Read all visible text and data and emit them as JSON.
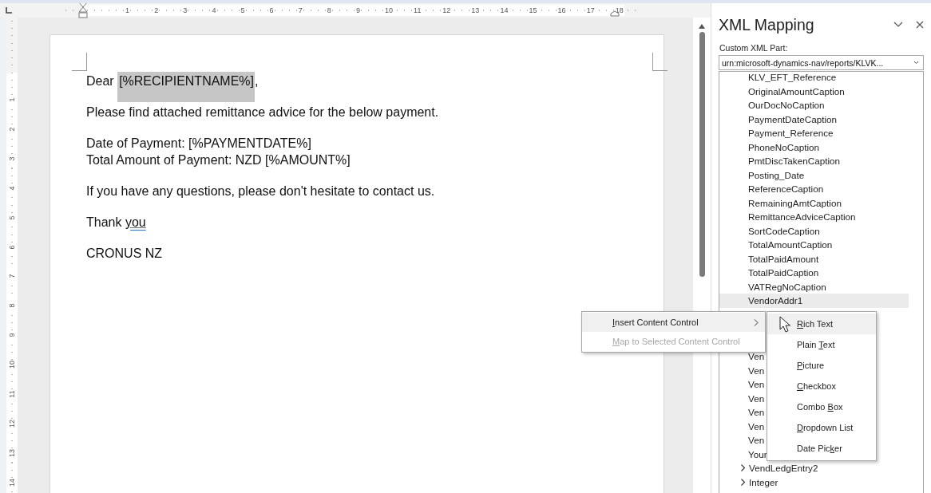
{
  "top_ruler": {
    "labels": [
      "1",
      "2",
      "3",
      "4",
      "5",
      "6",
      "7",
      "8",
      "9",
      "10",
      "11",
      "12",
      "13",
      "14",
      "15",
      "16",
      "17",
      "18"
    ]
  },
  "side_ruler": {
    "labels": [
      "1",
      "2",
      "3",
      "4",
      "5",
      "6",
      "7",
      "8",
      "9",
      "10",
      "11",
      "12",
      "13",
      "14"
    ]
  },
  "document": {
    "paragraphs": [
      {
        "lines": [
          {
            "parts": [
              {
                "text": "Dear "
              },
              {
                "text": "[%RECIPIENTNAME%]",
                "highlighted": true
              },
              {
                "text": ","
              }
            ]
          }
        ]
      },
      {
        "lines": [
          {
            "parts": [
              {
                "text": "Please find attached remittance advice for the below payment."
              }
            ]
          }
        ]
      },
      {
        "lines": [
          {
            "parts": [
              {
                "text": "Date of Payment: [%PAYMENTDATE%]"
              }
            ]
          },
          {
            "parts": [
              {
                "text": "Total Amount of Payment: NZD [%AMOUNT%]"
              }
            ]
          }
        ]
      },
      {
        "lines": [
          {
            "parts": [
              {
                "text": "If you have any questions, please don't hesitate to contact us."
              }
            ]
          }
        ]
      },
      {
        "lines": [
          {
            "parts": [
              {
                "text": "Thank "
              },
              {
                "text": "you",
                "flagged": true
              }
            ]
          }
        ]
      },
      {
        "lines": [
          {
            "parts": [
              {
                "text": "CRONUS NZ"
              }
            ]
          }
        ]
      }
    ]
  },
  "panel": {
    "title": "XML Mapping",
    "part_label": "Custom XML Part:",
    "part_value": "urn:microsoft-dynamics-nav/reports/KLVK...",
    "tree": [
      {
        "children": [
          {
            "label": "KLV_EFT_Reference",
            "selected": false
          },
          {
            "label": "OriginalAmountCaption",
            "selected": false
          },
          {
            "label": "OurDocNoCaption",
            "selected": false
          },
          {
            "label": "PaymentDateCaption",
            "selected": false
          },
          {
            "label": "Payment_Reference",
            "selected": false
          },
          {
            "label": "PhoneNoCaption",
            "selected": false
          },
          {
            "label": "PmtDiscTakenCaption",
            "selected": false
          },
          {
            "label": "Posting_Date",
            "selected": false
          },
          {
            "label": "ReferenceCaption",
            "selected": false
          },
          {
            "label": "RemainingAmtCaption",
            "selected": false
          },
          {
            "label": "RemittanceAdviceCaption",
            "selected": false
          },
          {
            "label": "SortCodeCaption",
            "selected": false
          },
          {
            "label": "TotalAmountCaption",
            "selected": false
          },
          {
            "label": "TotalPaidAmount",
            "selected": false
          },
          {
            "label": "TotalPaidCaption",
            "selected": false
          },
          {
            "label": "VATRegNoCaption",
            "selected": false
          },
          {
            "label": "VendorAddr1",
            "selected": true
          },
          {
            "label": "Ven",
            "selected": false
          },
          {
            "label": "Ven",
            "selected": false
          },
          {
            "label": "Ven",
            "selected": false
          },
          {
            "label": "Ven",
            "selected": false
          },
          {
            "label": "Ven",
            "selected": false
          },
          {
            "label": "Ven",
            "selected": false
          },
          {
            "label": "Ven",
            "selected": false
          },
          {
            "label": "Your",
            "selected": false
          }
        ]
      },
      {
        "label": "VendLedgEntry2",
        "expanded": false
      },
      {
        "label": "Integer",
        "expanded": false
      }
    ]
  },
  "context_menu": [
    {
      "key": "I",
      "post": "nsert Content Control",
      "selected": true,
      "disabled": false,
      "submenu": true
    },
    {
      "key": "M",
      "post": "ap to Selected Content Control",
      "selected": false,
      "disabled": true,
      "submenu": false
    }
  ],
  "submenu": [
    {
      "key": "R",
      "post": "ich Text",
      "selected": true
    },
    {
      "pre": "Plain ",
      "key": "T",
      "post": "ext",
      "selected": false
    },
    {
      "key": "P",
      "post": "icture",
      "selected": false
    },
    {
      "key": "C",
      "post": "heckbox",
      "selected": false
    },
    {
      "pre": "Combo ",
      "key": "B",
      "post": "ox",
      "selected": false
    },
    {
      "key": "D",
      "post": "ropdown List",
      "selected": false
    },
    {
      "pre": "Date Pic",
      "key": "k",
      "post": "er",
      "selected": false
    }
  ]
}
